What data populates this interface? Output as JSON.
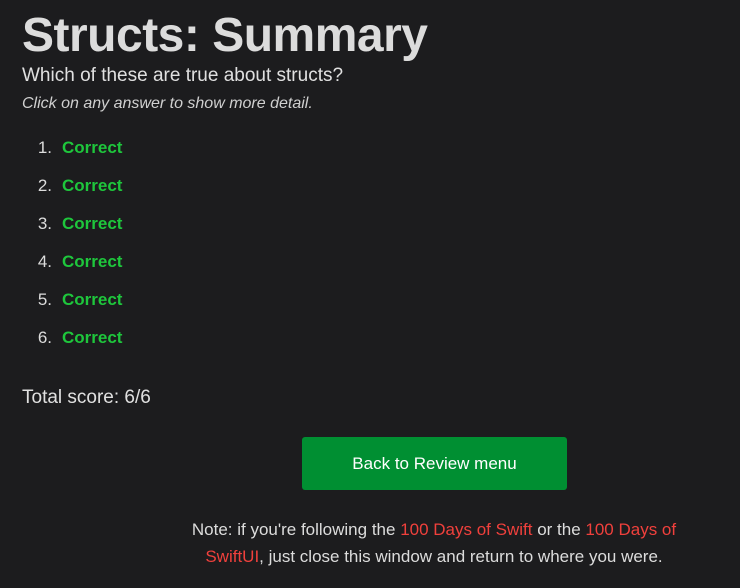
{
  "title": "Structs: Summary",
  "question": "Which of these are true about structs?",
  "hint": "Click on any answer to show more detail.",
  "answers": [
    {
      "number": "1.",
      "result": "Correct"
    },
    {
      "number": "2.",
      "result": "Correct"
    },
    {
      "number": "3.",
      "result": "Correct"
    },
    {
      "number": "4.",
      "result": "Correct"
    },
    {
      "number": "5.",
      "result": "Correct"
    },
    {
      "number": "6.",
      "result": "Correct"
    }
  ],
  "score": "Total score: 6/6",
  "back_button": "Back to Review menu",
  "note": {
    "prefix": "Note: if you're following the ",
    "link1": "100 Days of Swift",
    "middle": " or the ",
    "link2": "100 Days of SwiftUI",
    "suffix": ", just close this window and return to where you were."
  },
  "colors": {
    "background": "#1c1c1e",
    "correct": "#1ec63c",
    "button": "#008f32",
    "link": "#f0403c"
  }
}
